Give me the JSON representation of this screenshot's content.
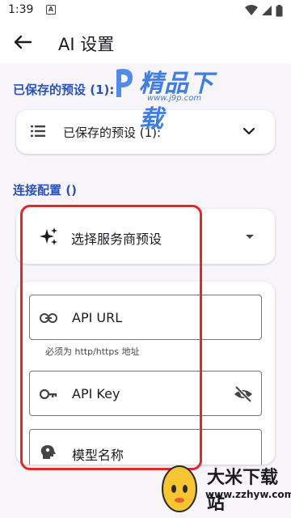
{
  "status_bar": {
    "time": "1:39",
    "notification_letter": "A"
  },
  "app_bar": {
    "title": "AI 设置"
  },
  "saved_presets": {
    "section_label": "已保存的预设 (1):",
    "dropdown_label": "已保存的预设 (1):"
  },
  "connection": {
    "section_label": "连接配置 ()",
    "provider_preset_label": "选择服务商预设",
    "fields": {
      "api_url_label": "API URL",
      "api_url_hint": "必须为 http/https 地址",
      "api_key_label": "API Key",
      "model_name_label": "模型名称"
    }
  },
  "watermarks": {
    "top_brand": "精品下载",
    "top_url": "www.j9p.com",
    "bottom_brand": "大米下载站",
    "bottom_url": "www.zzhyw.com"
  },
  "colors": {
    "accent": "#2b52b6",
    "highlight_box": "#e0272d",
    "background": "#f7f5fa"
  }
}
